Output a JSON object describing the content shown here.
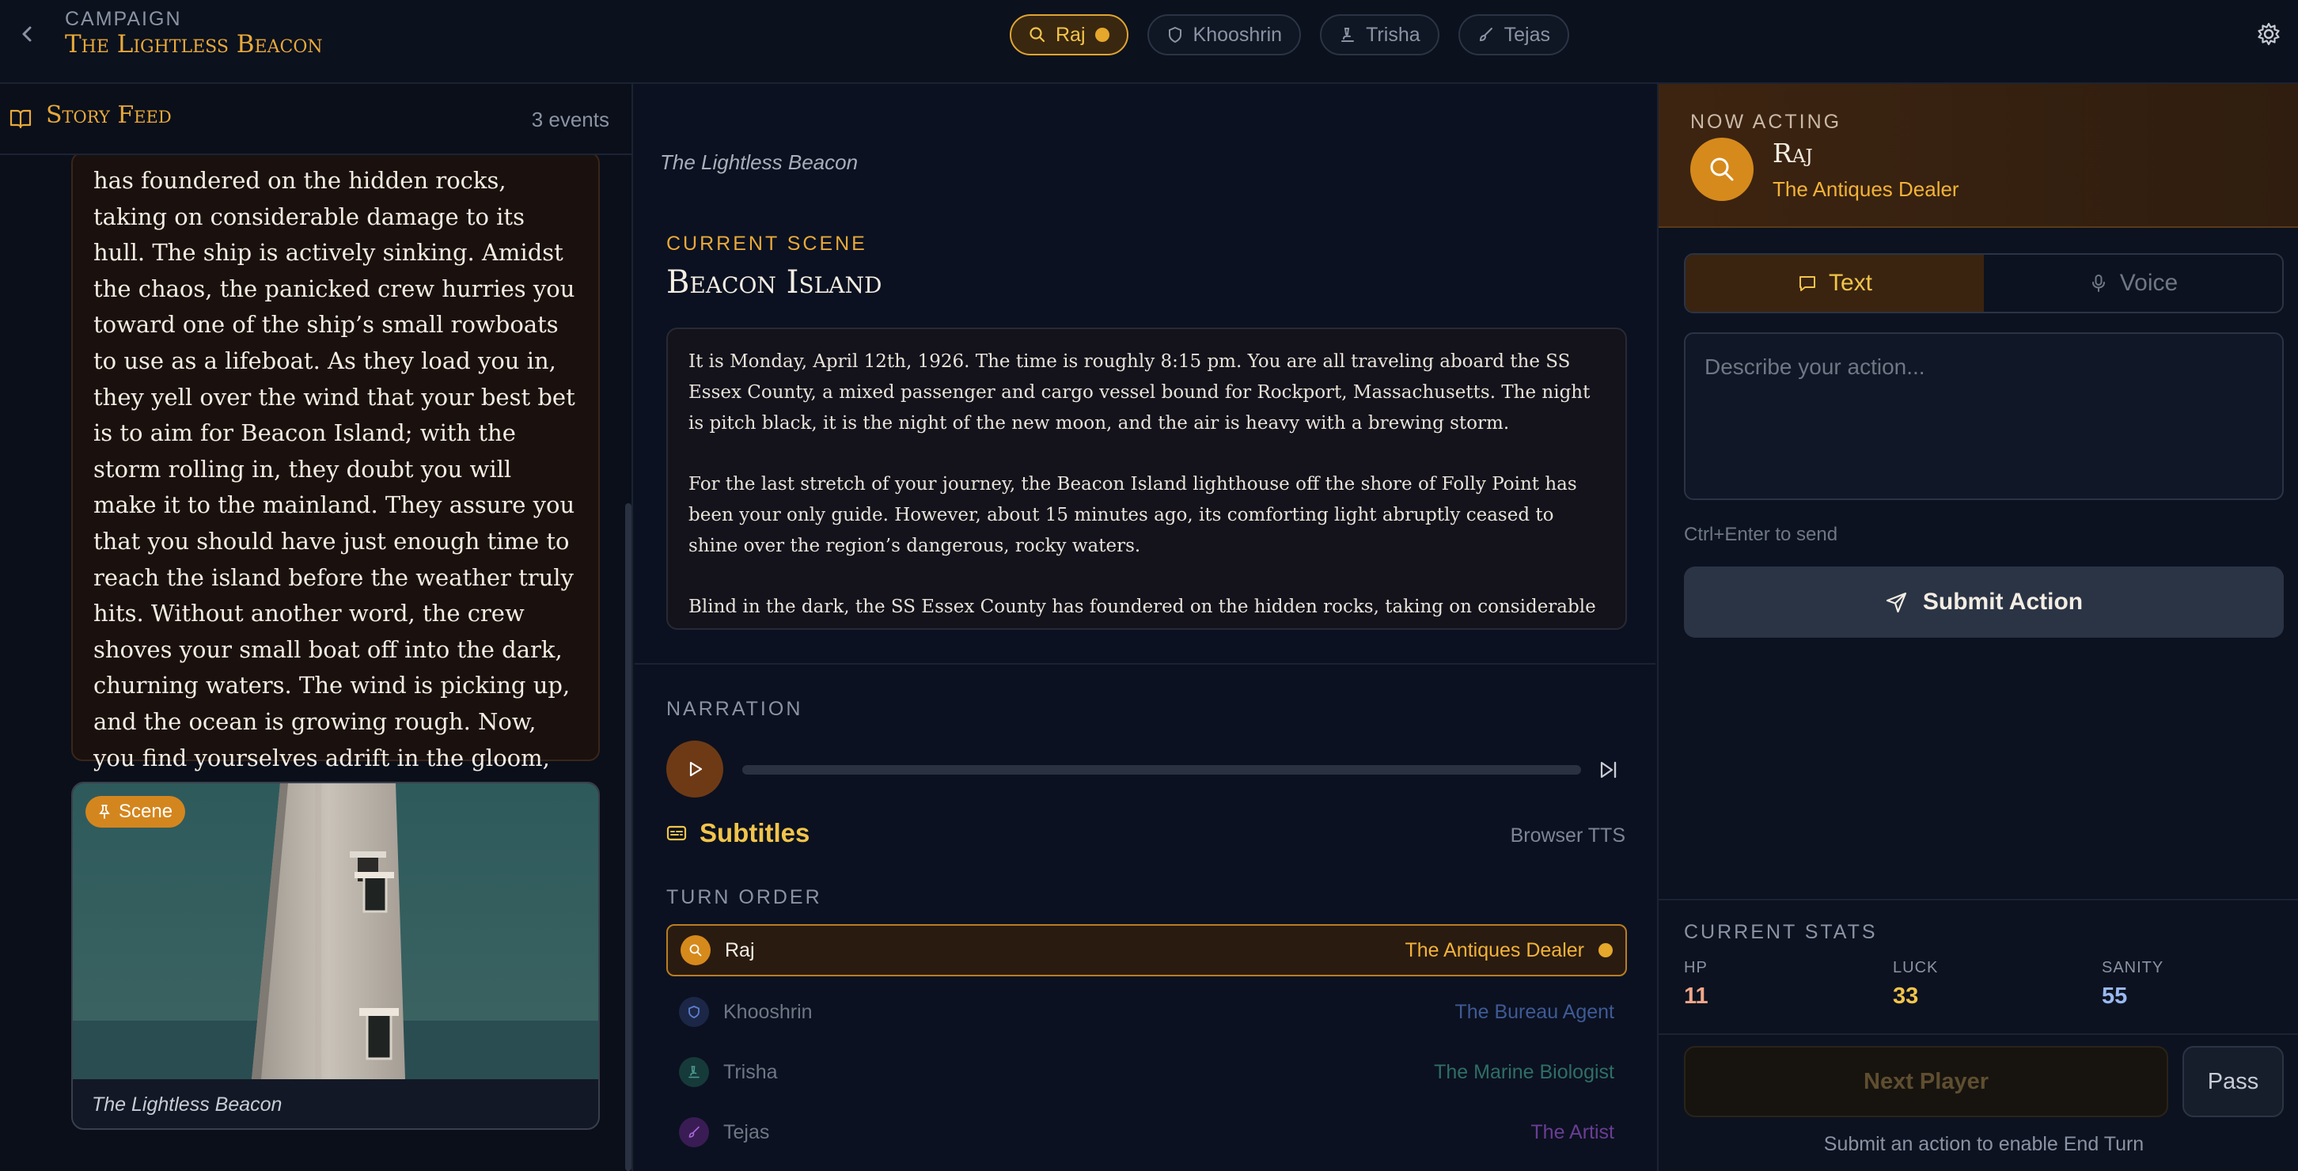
{
  "header": {
    "campaign_label": "CAMPAIGN",
    "campaign_title": "The Lightless Beacon",
    "players": [
      {
        "name": "Raj",
        "icon": "search-icon",
        "active": true
      },
      {
        "name": "Khooshrin",
        "icon": "shield-icon",
        "active": false
      },
      {
        "name": "Trisha",
        "icon": "microscope-icon",
        "active": false
      },
      {
        "name": "Tejas",
        "icon": "brush-icon",
        "active": false
      }
    ]
  },
  "story_feed": {
    "title": "Story Feed",
    "count": "3 events",
    "story_text": "has foundered on the hidden rocks, taking on considerable damage to its hull. The ship is actively sinking. Amidst the chaos, the panicked crew hurries you toward one of the ship’s small rowboats to use as a lifeboat. As they load you in, they yell over the wind that your best bet is to aim for Beacon Island; with the storm rolling in, they doubt you will make it to the mainland. They assure you that you should have just enough time to reach the island before the weather truly hits. Without another word, the crew shoves your small boat off into the dark, churning waters. The wind is picking up, and the ocean is growing rough. Now, you find yourselves adrift in the gloom, with nothing to guide you but a small, steady light shining at the base of the lighthouse’s towering silhouette in the distance.",
    "scene_badge": "Scene",
    "scene_caption": "The Lightless Beacon"
  },
  "center": {
    "campaign_subtitle": "The Lightless Beacon",
    "current_scene_label": "CURRENT SCENE",
    "scene_title": "Beacon Island",
    "scene_paragraphs": [
      "It is Monday, April 12th, 1926. The time is roughly 8:15 pm. You are all traveling aboard the SS Essex County, a mixed passenger and cargo vessel bound for Rockport, Massachusetts. The night is pitch black, it is the night of the new moon, and the air is heavy with a brewing storm.",
      "For the last stretch of your journey, the Beacon Island lighthouse off the shore of Folly Point has been your only guide. However, about 15 minutes ago, its comforting light abruptly ceased to shine over the region’s dangerous, rocky waters.",
      "Blind in the dark, the SS Essex County has foundered on the hidden rocks, taking on considerable damage to its hull."
    ],
    "narration_label": "NARRATION",
    "narration_progress": 0,
    "subtitles_label": "Subtitles",
    "tts_label": "Browser TTS",
    "turn_order_label": "TURN ORDER",
    "turn_order": [
      {
        "name": "Raj",
        "role": "The Antiques Dealer",
        "icon": "search-icon",
        "color": "#e0a532",
        "active": true
      },
      {
        "name": "Khooshrin",
        "role": "The Bureau Agent",
        "icon": "shield-icon",
        "color": "#3b5fa8",
        "active": false
      },
      {
        "name": "Trisha",
        "role": "The Marine Biologist",
        "icon": "microscope-icon",
        "color": "#2f6e6a",
        "active": false
      },
      {
        "name": "Tejas",
        "role": "The Artist",
        "icon": "brush-icon",
        "color": "#7a3aa8",
        "active": false
      }
    ]
  },
  "action_panel": {
    "now_acting_label": "NOW ACTING",
    "player_name": "Raj",
    "player_role": "The Antiques Dealer",
    "mode_text": "Text",
    "mode_voice": "Voice",
    "input_placeholder": "Describe your action...",
    "hint": "Ctrl+Enter to send",
    "submit_label": "Submit Action",
    "stats_label": "CURRENT STATS",
    "stats": [
      {
        "label": "HP",
        "value": "11",
        "color": "#f2a78a"
      },
      {
        "label": "LUCK",
        "value": "33",
        "color": "#f2c44a"
      },
      {
        "label": "SANITY",
        "value": "55",
        "color": "#9ab8f0"
      }
    ],
    "next_player_label": "Next Player",
    "pass_label": "Pass",
    "end_turn_hint": "Submit an action to enable End Turn"
  },
  "colors": {
    "accent": "#e9a93a",
    "background": "#0c1220",
    "active_chip": "#3a2710"
  }
}
